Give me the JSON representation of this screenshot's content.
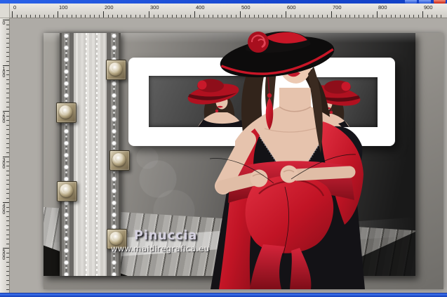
{
  "window": {
    "buttons": [
      {
        "name": "minimize"
      },
      {
        "name": "maximize"
      },
      {
        "name": "close"
      }
    ],
    "titlebar_color": "#1d4ed8",
    "bottombar_color": "#1d46c8"
  },
  "rulers": {
    "top_labels": [
      "0",
      "100",
      "200",
      "300",
      "400",
      "500",
      "600",
      "700",
      "800",
      "900"
    ],
    "left_labels": [
      "0",
      "100",
      "200",
      "300",
      "400",
      "500"
    ]
  },
  "artwork": {
    "signature": "Pinuccia",
    "website": "www.maidiregrafica.eu",
    "colors": {
      "accent_red": "#c11425",
      "hat_black": "#121010",
      "frame_white": "#ffffff",
      "canvas_gray": "#aeaba6",
      "ruler_bg": "#d8d4ce",
      "stud_bronze": "#a9996f",
      "skin": "#e6c3ad",
      "hair_brown": "#32241b"
    }
  }
}
